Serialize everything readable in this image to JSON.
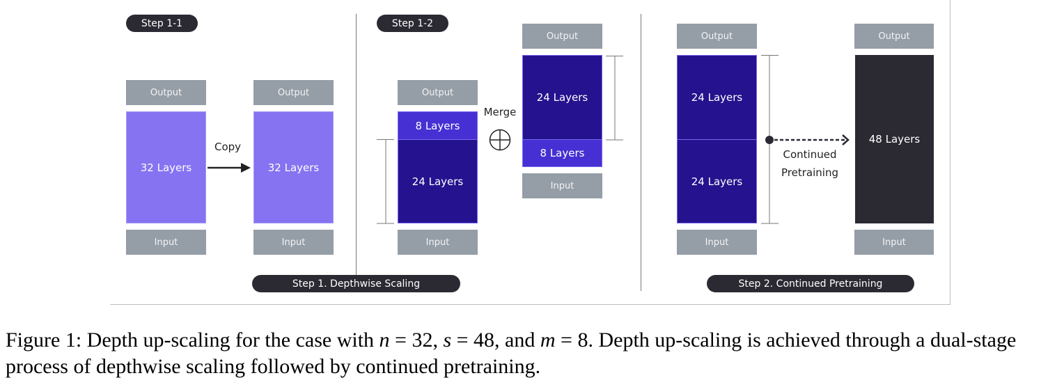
{
  "figure": {
    "step_labels": {
      "step_1_1": "Step 1-1",
      "step_1_2": "Step 1-2",
      "step_1": "Step 1.  Depthwise Scaling",
      "step_2": "Step 2. Continued Pretraining"
    },
    "io": {
      "output": "Output",
      "input": "Input"
    },
    "step_1_1": {
      "left_block": "32 Layers",
      "right_block": "32 Layers",
      "arrow_label": "Copy"
    },
    "step_1_2": {
      "left_top": "8 Layers",
      "left_bottom": "24 Layers",
      "right_top": "24 Layers",
      "right_bottom": "8 Layers",
      "merge_label": "Merge"
    },
    "step_2": {
      "top": "24 Layers",
      "bottom": "24 Layers",
      "arrow_label_line1": "Continued",
      "arrow_label_line2": "Pretraining",
      "result": "48 Layers"
    },
    "colors": {
      "light_purple": "#8673f1",
      "dark_indigo": "#25128e",
      "mid_indigo": "#4630d3",
      "io_gray": "#959da6",
      "pill_dark": "#2b2a33"
    }
  },
  "caption": {
    "part1": "Figure 1: Depth up-scaling for the case with ",
    "n_var": "n",
    "n_eq": " = 32, ",
    "s_var": "s",
    "s_eq": " = 48, and ",
    "m_var": "m",
    "m_eq": " = 8. Depth up-scaling is achieved through a dual-stage process of depthwise scaling followed by continued pretraining."
  }
}
